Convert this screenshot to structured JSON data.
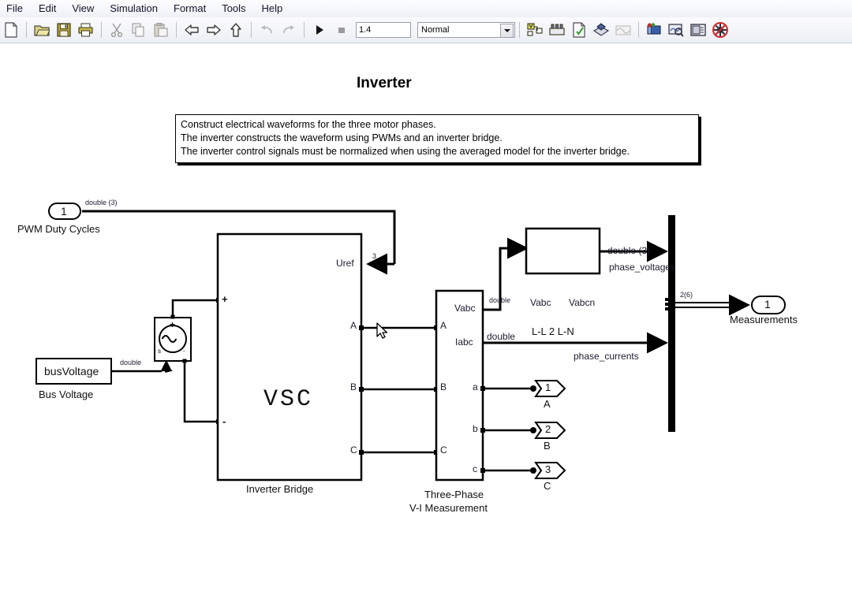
{
  "window": {
    "menu": [
      "File",
      "Edit",
      "View",
      "Simulation",
      "Format",
      "Tools",
      "Help"
    ],
    "toolbar": {
      "icons": [
        "new-model-icon",
        "open-model-icon",
        "save-model-icon",
        "print-icon",
        "cut-icon",
        "copy-icon",
        "paste-icon",
        "back-icon",
        "forward-icon",
        "up-level-icon",
        "undo-icon",
        "redo-icon",
        "start-simulation-icon",
        "stop-simulation-icon"
      ],
      "icons_right": [
        "update-diagram-icon",
        "build-model-icon",
        "model-explorer-icon",
        "library-browser-icon",
        "toggle-scope-icon",
        "debug-icon",
        "model-advisor-icon",
        "model-properties-icon",
        "disable-link-icon"
      ],
      "simulation_stop_time": "1.4",
      "simulation_mode": "Normal"
    }
  },
  "diagram": {
    "title": "Inverter",
    "description": [
      "Construct electrical waveforms for the three motor phases.",
      "The inverter constructs the waveform using PWMs and an inverter bridge.",
      "The inverter control signals must be normalized when using the averaged model for the inverter bridge."
    ],
    "blocks": {
      "pwm_inport": {
        "number": "1",
        "name": "PWM Duty Cycles"
      },
      "bus_voltage": {
        "text": "busVoltage",
        "name": "Bus Voltage"
      },
      "voltage_source": {
        "plus": "+",
        "s": "s",
        "minus": "-"
      },
      "inverter_bridge": {
        "text": "VSC",
        "name": "Inverter Bridge",
        "ports": {
          "uref": "Uref",
          "a": "A",
          "b": "B",
          "c": "C",
          "plus": "+",
          "minus": "-"
        }
      },
      "vi_measurement": {
        "name_line1": "Three-Phase",
        "name_line2": "V-I Measurement",
        "ports": {
          "in_a": "A",
          "in_b": "B",
          "in_c": "C",
          "vabc": "Vabc",
          "iabc": "Iabc",
          "out_a": "a",
          "out_b": "b",
          "out_c": "c"
        }
      },
      "ll_2_ln": {
        "name": "L-L 2 L-N",
        "in": "Vabc",
        "out": "Vabcn"
      },
      "outport_a": {
        "number": "1",
        "name": "A"
      },
      "outport_b": {
        "number": "2",
        "name": "B"
      },
      "outport_c": {
        "number": "3",
        "name": "C"
      },
      "outport_measurements": {
        "number": "1",
        "name": "Measurements"
      }
    },
    "signals": {
      "pwm": "double (3)",
      "uref_width": "3",
      "bus_voltage": "double",
      "vabc": "double",
      "iabc": "double",
      "phase_voltages_type": "double (3)",
      "phase_voltages": "phase_voltages",
      "phase_currents": "phase_currents",
      "bus_measurements": "2(6)"
    }
  }
}
